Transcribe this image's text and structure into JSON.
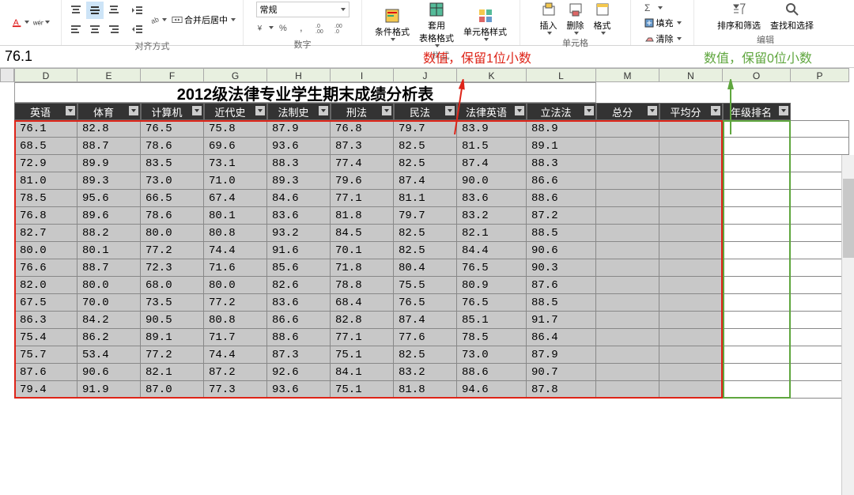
{
  "ribbon": {
    "groups": {
      "alignment": "对齐方式",
      "number": "数字",
      "styles": "样式",
      "cells": "单元格",
      "editing": "编辑"
    },
    "buttons": {
      "merge": "合并后居中",
      "general": "常规",
      "conditional": "条件格式",
      "formatTable": "套用\n表格格式",
      "cellStyles": "单元格样式",
      "insert": "插入",
      "delete": "删除",
      "format": "格式",
      "fill": "填充",
      "clear": "清除",
      "sort": "排序和筛选",
      "find": "查找和选择"
    }
  },
  "formula_bar": {
    "value": "76.1"
  },
  "annotations": {
    "red": "数值，保留1位小数",
    "green": "数值，保留0位小数"
  },
  "columns": {
    "letters": [
      "D",
      "E",
      "F",
      "G",
      "H",
      "I",
      "J",
      "K",
      "L",
      "M",
      "N",
      "O",
      "P"
    ],
    "widths": [
      80,
      80,
      80,
      80,
      80,
      80,
      80,
      88,
      88,
      80,
      80,
      86,
      74
    ]
  },
  "title": "2012级法律专业学生期末成绩分析表",
  "headers": [
    "英语",
    "体育",
    "计算机",
    "近代史",
    "法制史",
    "刑法",
    "民法",
    "法律英语",
    "立法法",
    "总分",
    "平均分",
    "年级排名"
  ],
  "chart_data": {
    "type": "table",
    "columns": [
      "英语",
      "体育",
      "计算机",
      "近代史",
      "法制史",
      "刑法",
      "民法",
      "法律英语",
      "立法法"
    ],
    "rows": [
      [
        76.1,
        82.8,
        76.5,
        75.8,
        87.9,
        76.8,
        79.7,
        83.9,
        88.9
      ],
      [
        68.5,
        88.7,
        78.6,
        69.6,
        93.6,
        87.3,
        82.5,
        81.5,
        89.1
      ],
      [
        72.9,
        89.9,
        83.5,
        73.1,
        88.3,
        77.4,
        82.5,
        87.4,
        88.3
      ],
      [
        81.0,
        89.3,
        73.0,
        71.0,
        89.3,
        79.6,
        87.4,
        90.0,
        86.6
      ],
      [
        78.5,
        95.6,
        66.5,
        67.4,
        84.6,
        77.1,
        81.1,
        83.6,
        88.6
      ],
      [
        76.8,
        89.6,
        78.6,
        80.1,
        83.6,
        81.8,
        79.7,
        83.2,
        87.2
      ],
      [
        82.7,
        88.2,
        80.0,
        80.8,
        93.2,
        84.5,
        82.5,
        82.1,
        88.5
      ],
      [
        80.0,
        80.1,
        77.2,
        74.4,
        91.6,
        70.1,
        82.5,
        84.4,
        90.6
      ],
      [
        76.6,
        88.7,
        72.3,
        71.6,
        85.6,
        71.8,
        80.4,
        76.5,
        90.3
      ],
      [
        82.0,
        80.0,
        68.0,
        80.0,
        82.6,
        78.8,
        75.5,
        80.9,
        87.6
      ],
      [
        67.5,
        70.0,
        73.5,
        77.2,
        83.6,
        68.4,
        76.5,
        76.5,
        88.5
      ],
      [
        86.3,
        84.2,
        90.5,
        80.8,
        86.6,
        82.8,
        87.4,
        85.1,
        91.7
      ],
      [
        75.4,
        86.2,
        89.1,
        71.7,
        88.6,
        77.1,
        77.6,
        78.5,
        86.4
      ],
      [
        75.7,
        53.4,
        77.2,
        74.4,
        87.3,
        75.1,
        82.5,
        73.0,
        87.9
      ],
      [
        87.6,
        90.6,
        82.1,
        87.2,
        92.6,
        84.1,
        83.2,
        88.6,
        90.7
      ],
      [
        79.4,
        91.9,
        87.0,
        77.3,
        93.6,
        75.1,
        81.8,
        94.6,
        87.8
      ]
    ]
  }
}
